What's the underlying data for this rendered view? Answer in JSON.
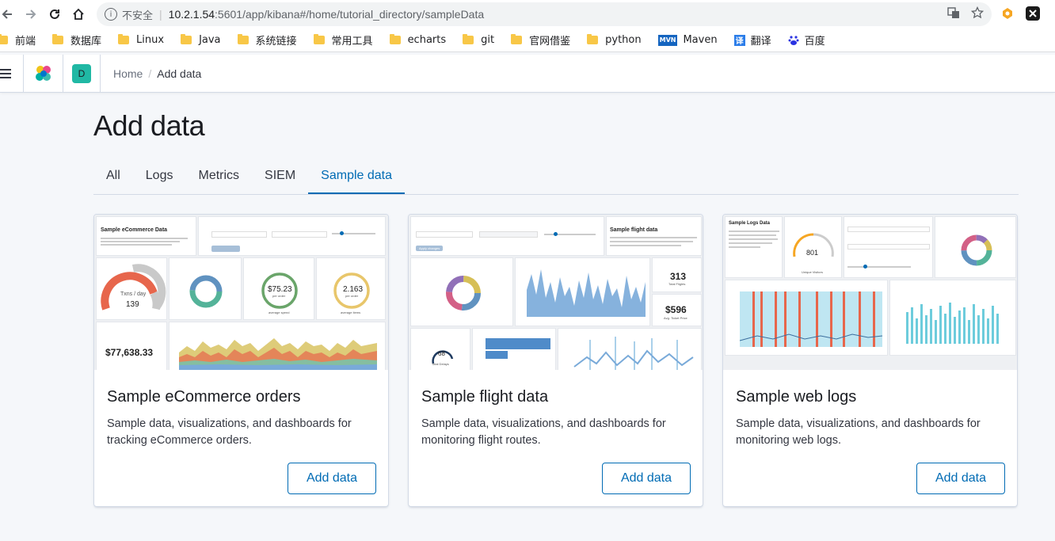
{
  "browser": {
    "security_label": "不安全",
    "url_host": "10.2.1.54",
    "url_path": ":5601/app/kibana#/home/tutorial_directory/sampleData",
    "bookmarks": [
      {
        "label": "前端",
        "icon": "folder-icon"
      },
      {
        "label": "数据库",
        "icon": "folder-icon"
      },
      {
        "label": "Linux",
        "icon": "folder-icon"
      },
      {
        "label": "Java",
        "icon": "folder-icon"
      },
      {
        "label": "系统链接",
        "icon": "folder-icon"
      },
      {
        "label": "常用工具",
        "icon": "folder-icon"
      },
      {
        "label": "echarts",
        "icon": "folder-icon"
      },
      {
        "label": "git",
        "icon": "folder-icon"
      },
      {
        "label": "官网借鉴",
        "icon": "folder-icon"
      },
      {
        "label": "python",
        "icon": "folder-icon"
      },
      {
        "label": "Maven",
        "icon": "mvn-icon"
      },
      {
        "label": "翻译",
        "icon": "translate-icon"
      },
      {
        "label": "百度",
        "icon": "baidu-icon"
      }
    ],
    "mvn_badge": "MVN",
    "translate_badge": "译"
  },
  "header": {
    "space_initial": "D",
    "breadcrumb_home": "Home",
    "breadcrumb_current": "Add data"
  },
  "page": {
    "title": "Add data",
    "tabs": [
      "All",
      "Logs",
      "Metrics",
      "SIEM",
      "Sample data"
    ],
    "active_tab": "Sample data"
  },
  "cards": [
    {
      "title": "Sample eCommerce orders",
      "description": "Sample data, visualizations, and dashboards for tracking eCommerce orders.",
      "button": "Add data",
      "thumb": {
        "heading": "Sample eCommerce Data",
        "gauge_label": "Txns / day",
        "gauge_value": "139",
        "avg_spend": "$75.23",
        "avg_spend_sub": "per order",
        "avg_items": "2.163",
        "avg_items_sub": "per order",
        "revenue": "$77,638.33",
        "avg_spend_caption": "average spend",
        "avg_items_caption": "average items"
      }
    },
    {
      "title": "Sample flight data",
      "description": "Sample data, visualizations, and dashboards for monitoring flight routes.",
      "button": "Add data",
      "thumb": {
        "heading": "Sample flight data",
        "total_flights": "313",
        "total_flights_sub": "Total Flights",
        "avg_price": "$596",
        "avg_price_sub": "Avg. Ticket Price",
        "delays": "68",
        "delays_sub": "Total Delays",
        "apply_label": "Apply changes"
      }
    },
    {
      "title": "Sample web logs",
      "description": "Sample data, visualizations, and dashboards for monitoring web logs.",
      "button": "Add data",
      "thumb": {
        "heading": "Sample Logs Data",
        "visitors": "801",
        "visitors_sub": "Unique Visitors"
      }
    }
  ],
  "colors": {
    "accent": "#006bb4",
    "title": "#1a1c21",
    "background": "#f5f7fa",
    "space_avatar": "#20b8a4"
  }
}
